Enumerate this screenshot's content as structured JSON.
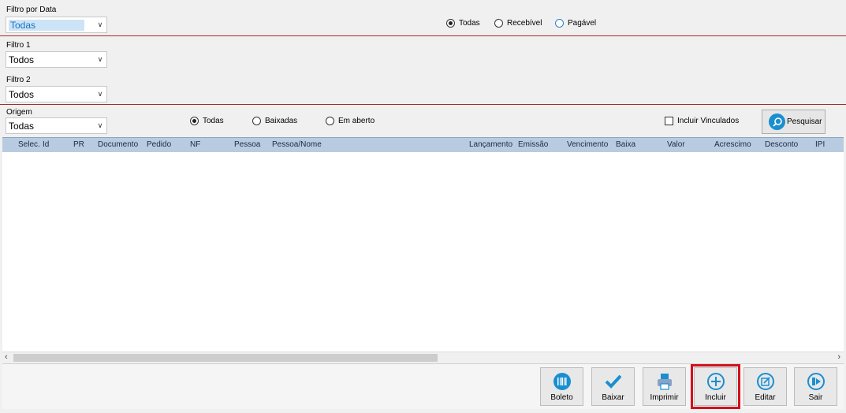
{
  "filters": {
    "filtro_data": {
      "label": "Filtro por Data",
      "value": "Todas"
    },
    "filtro1": {
      "label": "Filtro 1",
      "value": "Todos"
    },
    "filtro2": {
      "label": "Filtro 2",
      "value": "Todos"
    },
    "origem": {
      "label": "Origem",
      "value": "Todas"
    }
  },
  "tipo_radios": [
    {
      "label": "Todas",
      "checked": true
    },
    {
      "label": "Recebível",
      "checked": false
    },
    {
      "label": "Pagável",
      "checked": false
    }
  ],
  "status_radios": [
    {
      "label": "Todas",
      "checked": true
    },
    {
      "label": "Baixadas",
      "checked": false
    },
    {
      "label": "Em aberto",
      "checked": false
    }
  ],
  "incluir_vinculados": {
    "label": "Incluir Vinculados",
    "checked": false
  },
  "search_button": {
    "label": "Pesquisar"
  },
  "grid": {
    "columns": [
      "Selec.",
      "Id",
      "PR",
      "Documento",
      "Pedido",
      "NF",
      "Pessoa",
      "Pessoa/Nome",
      "Lançamento",
      "Emissão",
      "Vencimento",
      "Baixa",
      "Valor",
      "Acrescimo",
      "Desconto",
      "IPI"
    ],
    "rows": []
  },
  "toolbar": {
    "boleto": "Boleto",
    "baixar": "Baixar",
    "imprimir": "Imprimir",
    "incluir": "Incluir",
    "editar": "Editar",
    "sair": "Sair"
  },
  "colors": {
    "accent": "#1a8fd0",
    "separator": "#a52a2a",
    "highlight": "#d0121b",
    "header": "#b8cbe0"
  }
}
